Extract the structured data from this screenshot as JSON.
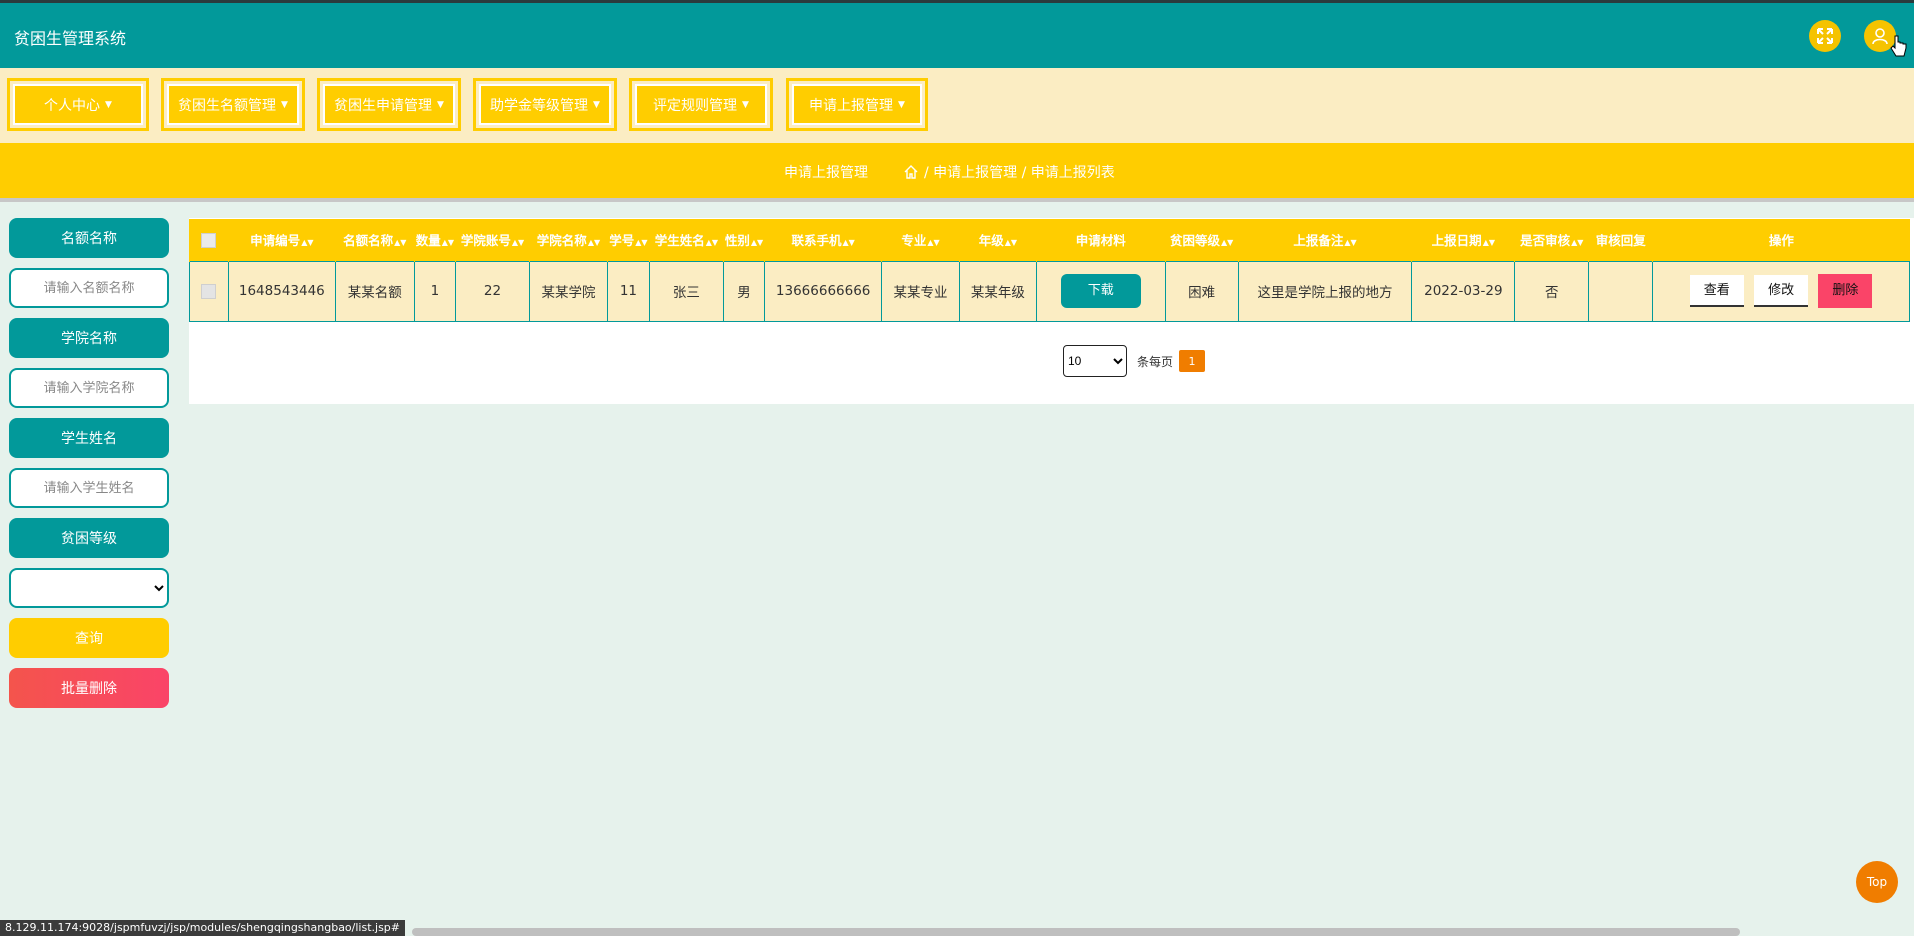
{
  "header": {
    "title": "贫困生管理系统",
    "fullscreen_icon": "expand-icon",
    "user_icon": "user-icon"
  },
  "menu": [
    {
      "label": "个人中心"
    },
    {
      "label": "贫困生名额管理"
    },
    {
      "label": "贫困生申请管理"
    },
    {
      "label": "助学金等级管理"
    },
    {
      "label": "评定规则管理"
    },
    {
      "label": "申请上报管理"
    }
  ],
  "breadcrumb": {
    "title": "申请上报管理",
    "path": "/ 申请上报管理 / 申请上报列表"
  },
  "filters": {
    "quota_label": "名额名称",
    "quota_placeholder": "请输入名额名称",
    "college_label": "学院名称",
    "college_placeholder": "请输入学院名称",
    "student_label": "学生姓名",
    "student_placeholder": "请输入学生姓名",
    "level_label": "贫困等级",
    "level_value": "",
    "query_label": "查询",
    "batch_delete_label": "批量删除"
  },
  "table": {
    "columns": [
      "申请编号",
      "名额名称",
      "数量",
      "学院账号",
      "学院名称",
      "学号",
      "学生姓名",
      "性别",
      "联系手机",
      "专业",
      "年级",
      "申请材料",
      "贫困等级",
      "上报备注",
      "上报日期",
      "是否审核",
      "审核回复",
      "操作"
    ],
    "rows": [
      {
        "id": "1648543446",
        "quota": "某某名额",
        "count": "1",
        "college_account": "22",
        "college": "某某学院",
        "student_no": "11",
        "name": "张三",
        "gender": "男",
        "phone": "13666666666",
        "major": "某某专业",
        "grade": "某某年级",
        "material_btn": "下载",
        "level": "困难",
        "remark": "这里是学院上报的地方",
        "date": "2022-03-29",
        "reviewed": "否",
        "reply": "",
        "view": "查看",
        "edit": "修改",
        "delete": "删除"
      }
    ]
  },
  "pagination": {
    "page_size": "10",
    "per_page_text": "条每页",
    "current_page": "1"
  },
  "status_url": "8.129.11.174:9028/jspmfuvzj/jsp/modules/shengqingshangbao/list.jsp#",
  "top_button": "Top",
  "colors": {
    "teal": "#02999a",
    "yellow": "#ffcd00",
    "cream": "#fbedc3",
    "red": "#fa4468",
    "orange": "#f07d00"
  }
}
